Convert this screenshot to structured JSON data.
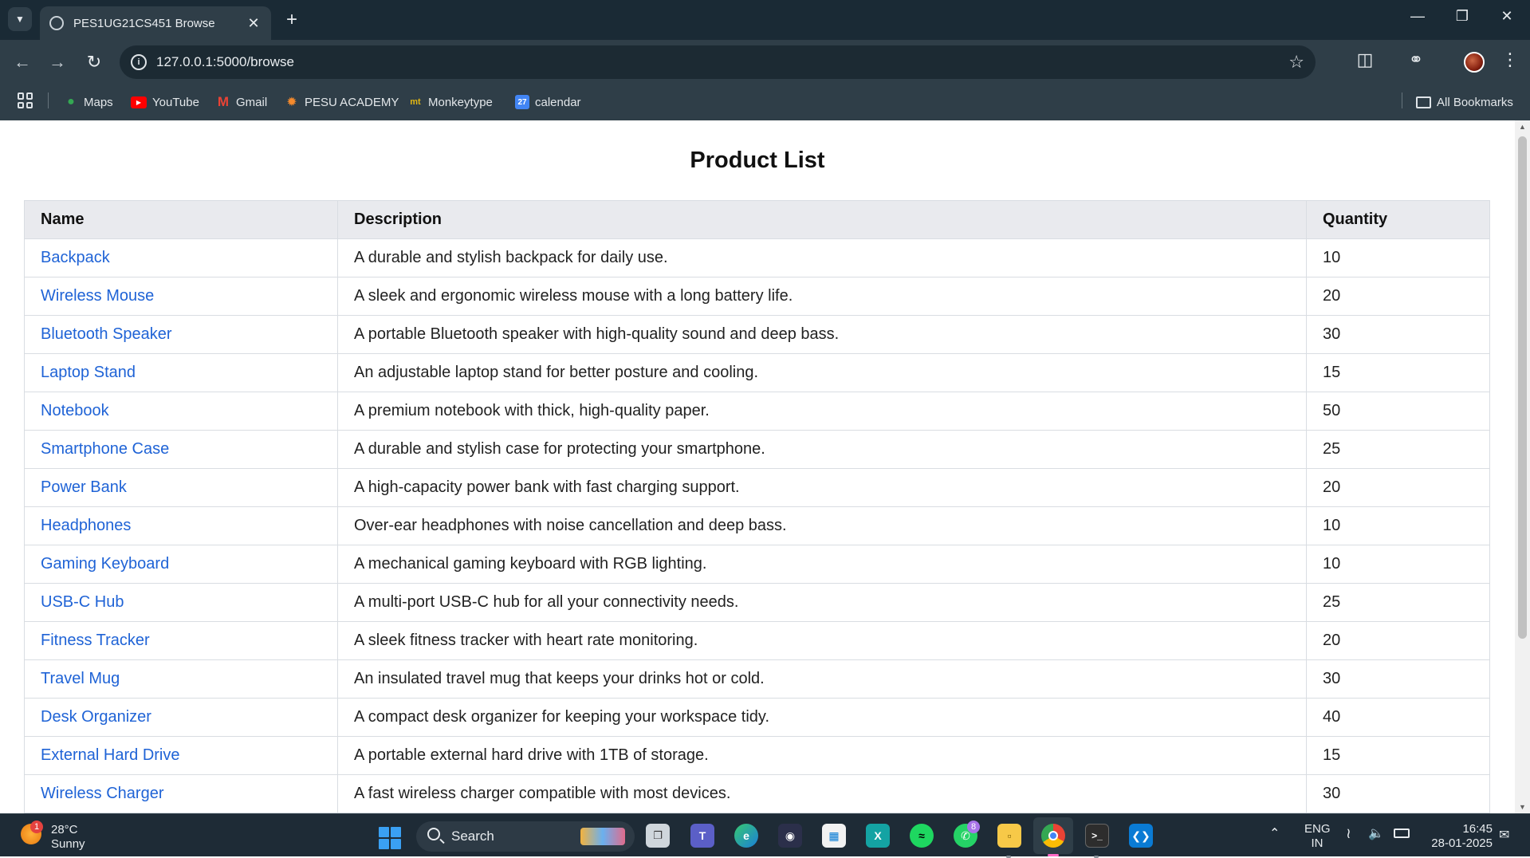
{
  "browser": {
    "tab_title": "PES1UG21CS451 Browse",
    "url": "127.0.0.1:5000/browse",
    "bookmarks": [
      {
        "label": "Maps",
        "icon": "maps-pin-icon"
      },
      {
        "label": "YouTube",
        "icon": "youtube-icon"
      },
      {
        "label": "Gmail",
        "icon": "gmail-icon"
      },
      {
        "label": "PESU ACADEMY",
        "icon": "pesu-icon"
      },
      {
        "label": "Monkeytype",
        "icon": "monkeytype-icon"
      },
      {
        "label": "calendar",
        "icon": "calendar-icon"
      }
    ],
    "all_bookmarks": "All Bookmarks",
    "calendar_icon_text": "27",
    "monkeytype_icon_text": "mt"
  },
  "page": {
    "title": "Product List",
    "columns": [
      "Name",
      "Description",
      "Quantity"
    ],
    "products": [
      {
        "name": "Backpack",
        "description": "A durable and stylish backpack for daily use.",
        "quantity": "10"
      },
      {
        "name": "Wireless Mouse",
        "description": "A sleek and ergonomic wireless mouse with a long battery life.",
        "quantity": "20"
      },
      {
        "name": "Bluetooth Speaker",
        "description": "A portable Bluetooth speaker with high-quality sound and deep bass.",
        "quantity": "30"
      },
      {
        "name": "Laptop Stand",
        "description": "An adjustable laptop stand for better posture and cooling.",
        "quantity": "15"
      },
      {
        "name": "Notebook",
        "description": "A premium notebook with thick, high-quality paper.",
        "quantity": "50"
      },
      {
        "name": "Smartphone Case",
        "description": "A durable and stylish case for protecting your smartphone.",
        "quantity": "25"
      },
      {
        "name": "Power Bank",
        "description": "A high-capacity power bank with fast charging support.",
        "quantity": "20"
      },
      {
        "name": "Headphones",
        "description": "Over-ear headphones with noise cancellation and deep bass.",
        "quantity": "10"
      },
      {
        "name": "Gaming Keyboard",
        "description": "A mechanical gaming keyboard with RGB lighting.",
        "quantity": "10"
      },
      {
        "name": "USB-C Hub",
        "description": "A multi-port USB-C hub for all your connectivity needs.",
        "quantity": "25"
      },
      {
        "name": "Fitness Tracker",
        "description": "A sleek fitness tracker with heart rate monitoring.",
        "quantity": "20"
      },
      {
        "name": "Travel Mug",
        "description": "An insulated travel mug that keeps your drinks hot or cold.",
        "quantity": "30"
      },
      {
        "name": "Desk Organizer",
        "description": "A compact desk organizer for keeping your workspace tidy.",
        "quantity": "40"
      },
      {
        "name": "External Hard Drive",
        "description": "A portable external hard drive with 1TB of storage.",
        "quantity": "15"
      },
      {
        "name": "Wireless Charger",
        "description": "A fast wireless charger compatible with most devices.",
        "quantity": "30"
      }
    ]
  },
  "taskbar": {
    "weather_temp": "28°C",
    "weather_desc": "Sunny",
    "weather_badge": "1",
    "search_label": "Search",
    "whatsapp_badge": "8",
    "lang_line1": "ENG",
    "lang_line2": "IN",
    "time": "16:45",
    "date": "28-01-2025"
  },
  "colors": {
    "link": "#1f63d6",
    "header_bg": "#e9eaee",
    "chrome_dark": "#1a2a35",
    "chrome_toolbar": "#2f3e48"
  }
}
